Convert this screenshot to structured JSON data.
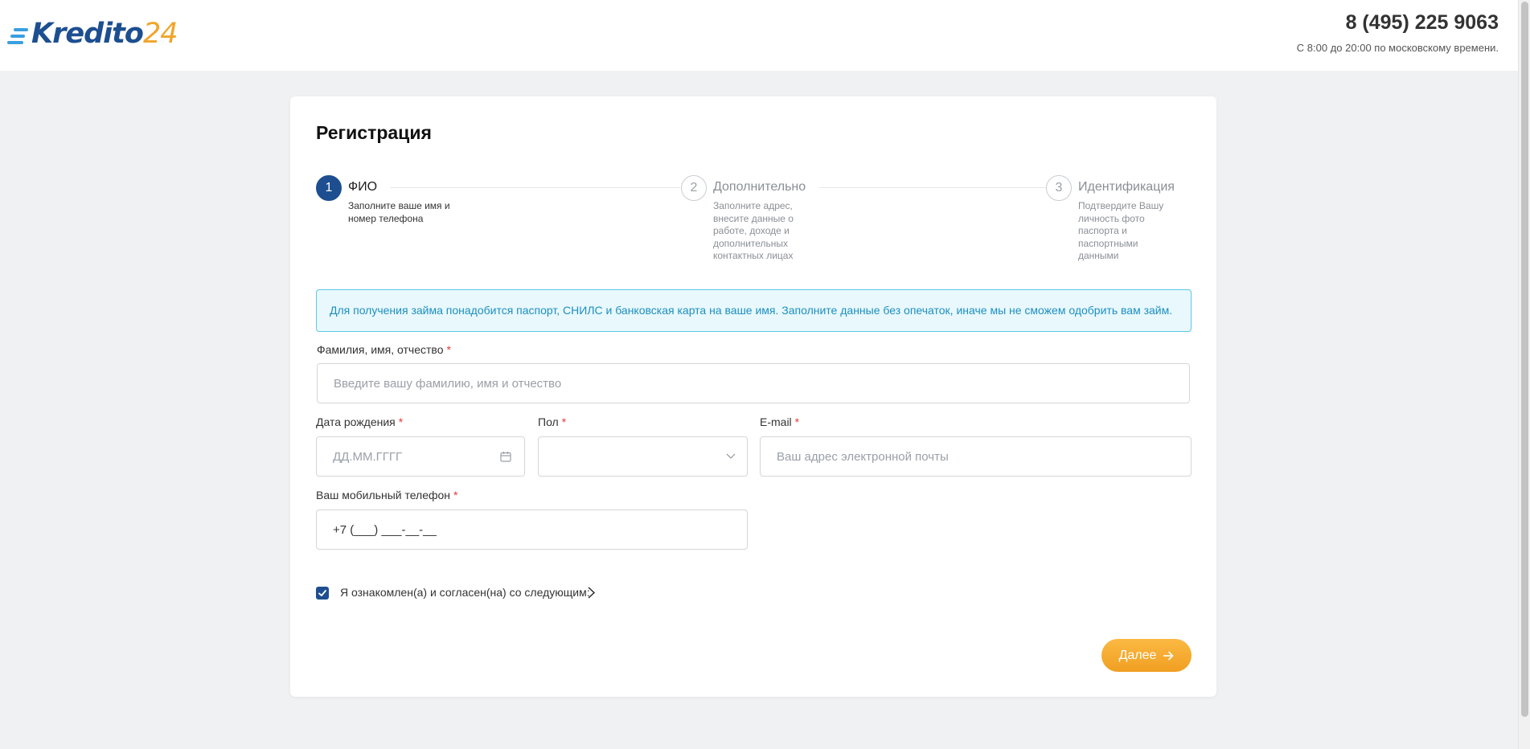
{
  "header": {
    "logo_brand": "Kredito",
    "logo_number": "24",
    "phone": "8 (495) 225 9063",
    "hours": "С 8:00 до 20:00 по московскому времени."
  },
  "form": {
    "title": "Регистрация",
    "steps": [
      {
        "number": "1",
        "title": "ФИО",
        "description": "Заполните ваше имя и номер телефона",
        "active": true
      },
      {
        "number": "2",
        "title": "Дополнительно",
        "description": "Заполните адрес, внесите данные о работе, доходе и дополнительных контактных лицах",
        "active": false
      },
      {
        "number": "3",
        "title": "Идентификация",
        "description": "Подтвердите Вашу личность фото паспорта и паспортными данными",
        "active": false
      }
    ],
    "notice": "Для получения займа понадобится паспорт, СНИЛС и банковская карта на ваше имя. Заполните данные без опечаток, иначе мы не сможем одобрить вам займ.",
    "fields": {
      "fullname": {
        "label": "Фамилия, имя, отчество",
        "placeholder": "Введите вашу фамилию, имя и отчество",
        "value": ""
      },
      "birthdate": {
        "label": "Дата рождения",
        "placeholder": "ДД.ММ.ГГГГ",
        "value": ""
      },
      "gender": {
        "label": "Пол",
        "value": ""
      },
      "email": {
        "label": "E-mail",
        "placeholder": "Ваш адрес электронной почты",
        "value": ""
      },
      "phone": {
        "label": "Ваш мобильный телефон",
        "value": "+7 (___) ___-__-__"
      }
    },
    "required_mark": "*",
    "agreement": {
      "checked": true,
      "label": "Я ознакомлен(а) и согласен(на) со следующим:"
    },
    "next_button": "Далее"
  },
  "colors": {
    "primary": "#1d4f90",
    "accent": "#f0a52a",
    "notice_bg": "#e8f8fc",
    "notice_text": "#1d8fc0",
    "required": "#e53935"
  }
}
